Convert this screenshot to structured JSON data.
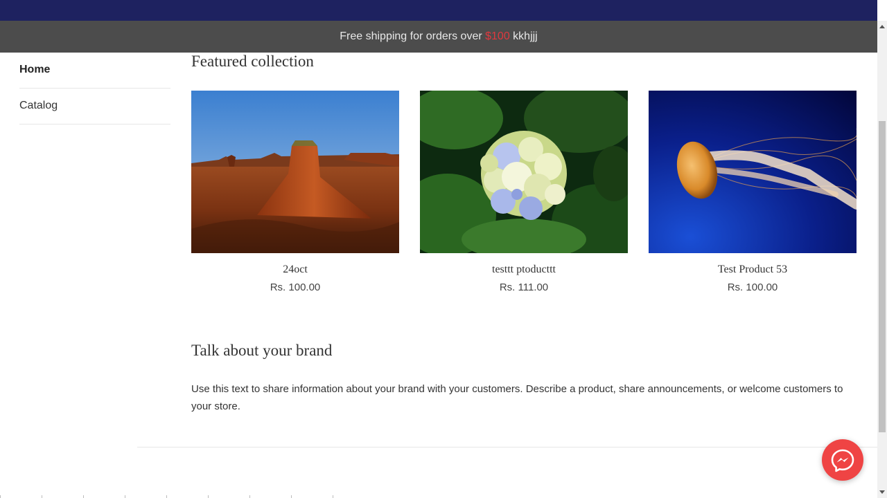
{
  "announcement": {
    "prefix": "Free shipping for orders over ",
    "price": "$100",
    "suffix": " kkhjjj"
  },
  "sidebar": {
    "items": [
      {
        "label": "Home",
        "active": true
      },
      {
        "label": "Catalog",
        "active": false
      }
    ]
  },
  "featured": {
    "title": "Featured collection",
    "products": [
      {
        "title": "24oct",
        "price": "Rs. 100.00",
        "image": "desert-mesa-image"
      },
      {
        "title": "testtt ptoducttt",
        "price": "Rs. 111.00",
        "image": "hydrangea-flower-image"
      },
      {
        "title": "Test Product 53",
        "price": "Rs. 100.00",
        "image": "jellyfish-image"
      }
    ]
  },
  "brand": {
    "title": "Talk about your brand",
    "text": "Use this text to share information about your brand with your customers. Describe a product, share announcements, or welcome customers to your store."
  },
  "colors": {
    "header": "#1e2260",
    "announcement_bg": "#4c4c4c",
    "price_accent": "#e0383e",
    "messenger": "#ef4444"
  },
  "icons": {
    "chat": "messenger-icon"
  }
}
